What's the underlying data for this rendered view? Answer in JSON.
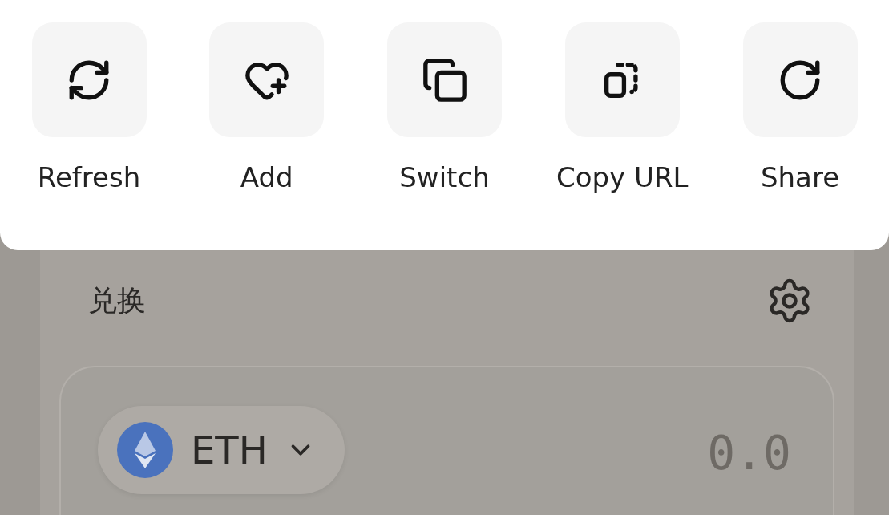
{
  "actions": [
    {
      "kind": "refresh",
      "label": "Refresh"
    },
    {
      "kind": "add",
      "label": "Add"
    },
    {
      "kind": "switch",
      "label": "Switch"
    },
    {
      "kind": "copy",
      "label": "Copy URL"
    },
    {
      "kind": "share",
      "label": "Share"
    }
  ],
  "swap": {
    "title": "兑换",
    "token": {
      "symbol": "ETH"
    },
    "amount": {
      "placeholder": "0.0"
    }
  }
}
